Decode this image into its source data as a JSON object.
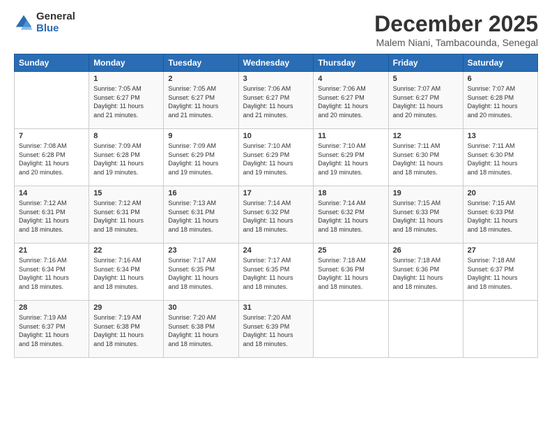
{
  "logo": {
    "general": "General",
    "blue": "Blue"
  },
  "header": {
    "month": "December 2025",
    "location": "Malem Niani, Tambacounda, Senegal"
  },
  "weekdays": [
    "Sunday",
    "Monday",
    "Tuesday",
    "Wednesday",
    "Thursday",
    "Friday",
    "Saturday"
  ],
  "weeks": [
    [
      {
        "day": "",
        "info": ""
      },
      {
        "day": "1",
        "info": "Sunrise: 7:05 AM\nSunset: 6:27 PM\nDaylight: 11 hours\nand 21 minutes."
      },
      {
        "day": "2",
        "info": "Sunrise: 7:05 AM\nSunset: 6:27 PM\nDaylight: 11 hours\nand 21 minutes."
      },
      {
        "day": "3",
        "info": "Sunrise: 7:06 AM\nSunset: 6:27 PM\nDaylight: 11 hours\nand 21 minutes."
      },
      {
        "day": "4",
        "info": "Sunrise: 7:06 AM\nSunset: 6:27 PM\nDaylight: 11 hours\nand 20 minutes."
      },
      {
        "day": "5",
        "info": "Sunrise: 7:07 AM\nSunset: 6:27 PM\nDaylight: 11 hours\nand 20 minutes."
      },
      {
        "day": "6",
        "info": "Sunrise: 7:07 AM\nSunset: 6:28 PM\nDaylight: 11 hours\nand 20 minutes."
      }
    ],
    [
      {
        "day": "7",
        "info": "Sunrise: 7:08 AM\nSunset: 6:28 PM\nDaylight: 11 hours\nand 20 minutes."
      },
      {
        "day": "8",
        "info": "Sunrise: 7:09 AM\nSunset: 6:28 PM\nDaylight: 11 hours\nand 19 minutes."
      },
      {
        "day": "9",
        "info": "Sunrise: 7:09 AM\nSunset: 6:29 PM\nDaylight: 11 hours\nand 19 minutes."
      },
      {
        "day": "10",
        "info": "Sunrise: 7:10 AM\nSunset: 6:29 PM\nDaylight: 11 hours\nand 19 minutes."
      },
      {
        "day": "11",
        "info": "Sunrise: 7:10 AM\nSunset: 6:29 PM\nDaylight: 11 hours\nand 19 minutes."
      },
      {
        "day": "12",
        "info": "Sunrise: 7:11 AM\nSunset: 6:30 PM\nDaylight: 11 hours\nand 18 minutes."
      },
      {
        "day": "13",
        "info": "Sunrise: 7:11 AM\nSunset: 6:30 PM\nDaylight: 11 hours\nand 18 minutes."
      }
    ],
    [
      {
        "day": "14",
        "info": "Sunrise: 7:12 AM\nSunset: 6:31 PM\nDaylight: 11 hours\nand 18 minutes."
      },
      {
        "day": "15",
        "info": "Sunrise: 7:12 AM\nSunset: 6:31 PM\nDaylight: 11 hours\nand 18 minutes."
      },
      {
        "day": "16",
        "info": "Sunrise: 7:13 AM\nSunset: 6:31 PM\nDaylight: 11 hours\nand 18 minutes."
      },
      {
        "day": "17",
        "info": "Sunrise: 7:14 AM\nSunset: 6:32 PM\nDaylight: 11 hours\nand 18 minutes."
      },
      {
        "day": "18",
        "info": "Sunrise: 7:14 AM\nSunset: 6:32 PM\nDaylight: 11 hours\nand 18 minutes."
      },
      {
        "day": "19",
        "info": "Sunrise: 7:15 AM\nSunset: 6:33 PM\nDaylight: 11 hours\nand 18 minutes."
      },
      {
        "day": "20",
        "info": "Sunrise: 7:15 AM\nSunset: 6:33 PM\nDaylight: 11 hours\nand 18 minutes."
      }
    ],
    [
      {
        "day": "21",
        "info": "Sunrise: 7:16 AM\nSunset: 6:34 PM\nDaylight: 11 hours\nand 18 minutes."
      },
      {
        "day": "22",
        "info": "Sunrise: 7:16 AM\nSunset: 6:34 PM\nDaylight: 11 hours\nand 18 minutes."
      },
      {
        "day": "23",
        "info": "Sunrise: 7:17 AM\nSunset: 6:35 PM\nDaylight: 11 hours\nand 18 minutes."
      },
      {
        "day": "24",
        "info": "Sunrise: 7:17 AM\nSunset: 6:35 PM\nDaylight: 11 hours\nand 18 minutes."
      },
      {
        "day": "25",
        "info": "Sunrise: 7:18 AM\nSunset: 6:36 PM\nDaylight: 11 hours\nand 18 minutes."
      },
      {
        "day": "26",
        "info": "Sunrise: 7:18 AM\nSunset: 6:36 PM\nDaylight: 11 hours\nand 18 minutes."
      },
      {
        "day": "27",
        "info": "Sunrise: 7:18 AM\nSunset: 6:37 PM\nDaylight: 11 hours\nand 18 minutes."
      }
    ],
    [
      {
        "day": "28",
        "info": "Sunrise: 7:19 AM\nSunset: 6:37 PM\nDaylight: 11 hours\nand 18 minutes."
      },
      {
        "day": "29",
        "info": "Sunrise: 7:19 AM\nSunset: 6:38 PM\nDaylight: 11 hours\nand 18 minutes."
      },
      {
        "day": "30",
        "info": "Sunrise: 7:20 AM\nSunset: 6:38 PM\nDaylight: 11 hours\nand 18 minutes."
      },
      {
        "day": "31",
        "info": "Sunrise: 7:20 AM\nSunset: 6:39 PM\nDaylight: 11 hours\nand 18 minutes."
      },
      {
        "day": "",
        "info": ""
      },
      {
        "day": "",
        "info": ""
      },
      {
        "day": "",
        "info": ""
      }
    ]
  ]
}
